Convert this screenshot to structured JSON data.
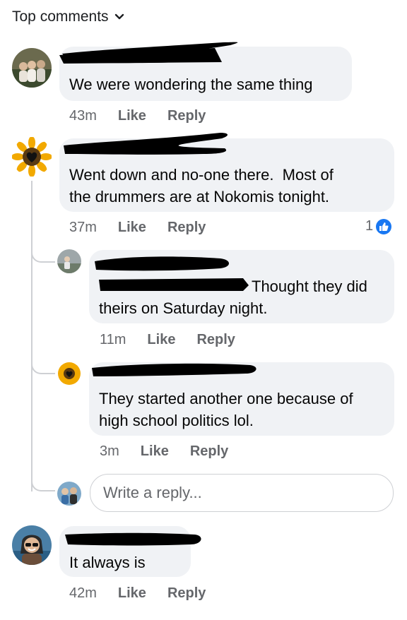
{
  "header": {
    "sort_label": "Top comments"
  },
  "comments": [
    {
      "text": "We were wondering the same thing",
      "time": "43m",
      "like": "Like",
      "reply": "Reply"
    },
    {
      "text": "Went down and no-one there.  Most of\nthe drummers are at Nokomis tonight.",
      "time": "37m",
      "like": "Like",
      "reply": "Reply",
      "reaction_count": "1",
      "replies": [
        {
          "text": "Thought they did\ntheirs on Saturday night.",
          "time": "11m",
          "like": "Like",
          "reply": "Reply"
        },
        {
          "text": "They started another one because of\nhigh school politics lol.",
          "time": "3m",
          "like": "Like",
          "reply": "Reply"
        }
      ],
      "reply_input_placeholder": "Write a reply..."
    },
    {
      "text": "It always is",
      "time": "42m",
      "like": "Like",
      "reply": "Reply"
    }
  ],
  "colors": {
    "bubble": "#f0f2f5",
    "meta": "#65676b",
    "like_blue": "#1877f2",
    "thread_line": "#ced0d4"
  }
}
